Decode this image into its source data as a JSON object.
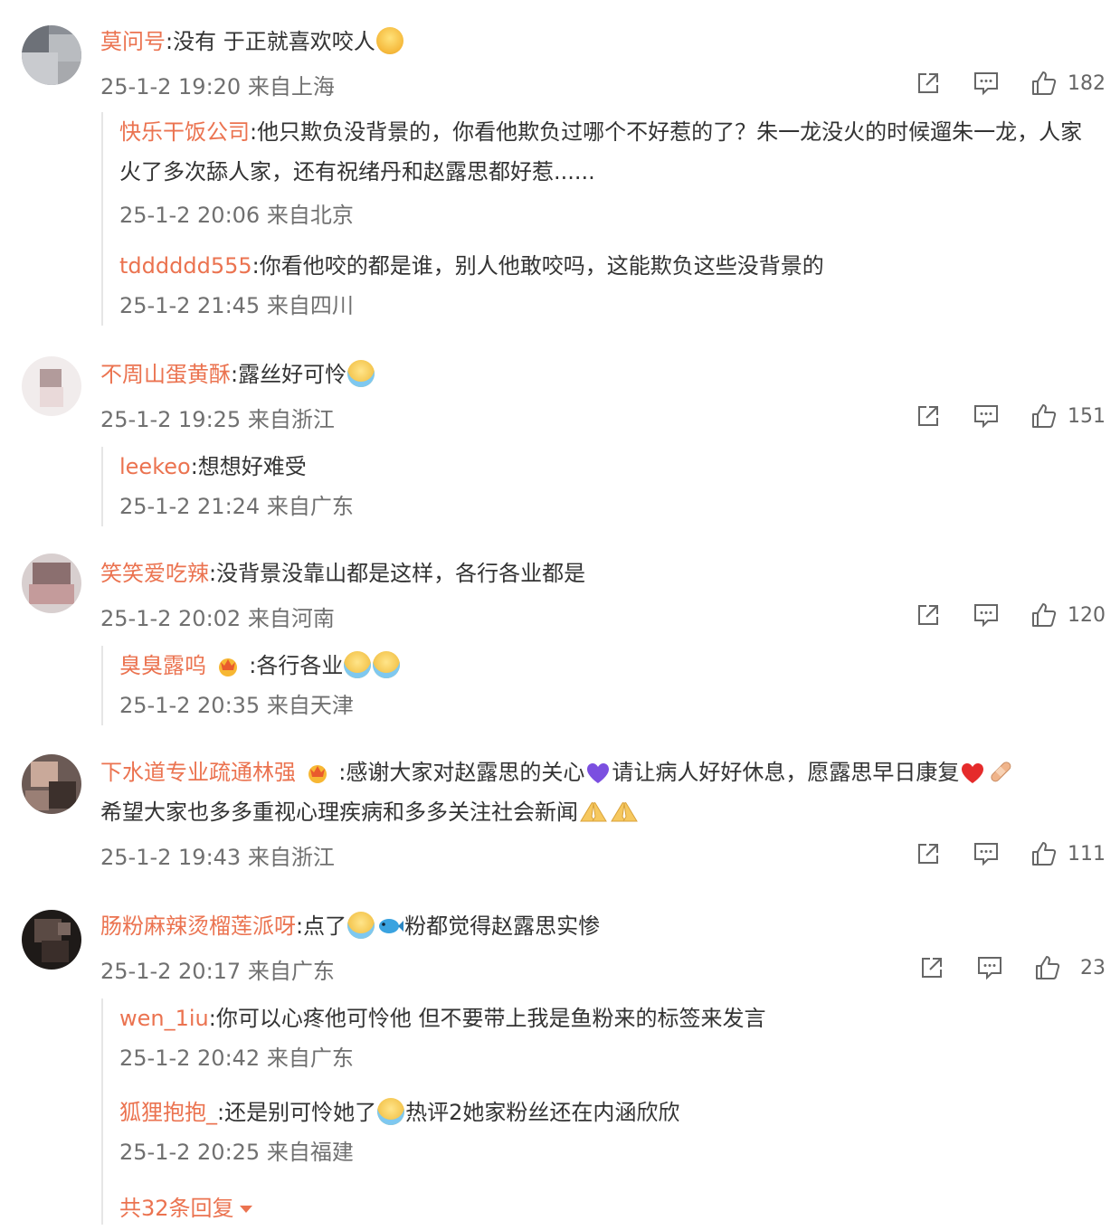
{
  "comments": [
    {
      "user": "莫问号",
      "text_before": ":没有  于正就喜欢咬人",
      "text_after": "",
      "emojis": [
        "laugh"
      ],
      "meta": "25-1-2 19:20 来自上海",
      "likes": "182",
      "replies": [
        {
          "user": "快乐干饭公司",
          "text": ":他只欺负没背景的，你看他欺负过哪个不好惹的了？朱一龙没火的时候遛朱一龙，人家火了多次舔人家，还有祝绪丹和赵露思都好惹......",
          "meta": "25-1-2 20:06 来自北京"
        },
        {
          "user": "tdddddd555",
          "text": ":你看他咬的都是谁，别人他敢咬吗，这能欺负这些没背景的",
          "meta": "25-1-2 21:45 来自四川"
        }
      ]
    },
    {
      "user": "不周山蛋黄酥",
      "text_before": ":露丝好可怜",
      "emojis": [
        "cry"
      ],
      "meta": "25-1-2 19:25 来自浙江",
      "likes": "151",
      "replies": [
        {
          "user": "leekeo",
          "text": ":想想好难受",
          "meta": "25-1-2 21:24 来自广东"
        }
      ]
    },
    {
      "user": "笑笑爱吃辣",
      "text_before": ":没背景没靠山都是这样，各行各业都是",
      "meta": "25-1-2 20:02 来自河南",
      "likes": "120",
      "replies": [
        {
          "user": "臭臭露呜",
          "text": " :各行各业",
          "meta": "25-1-2 20:35 来自天津"
        }
      ]
    },
    {
      "user": "下水道专业疏通林强",
      "text_line1_a": " :感谢大家对赵露思的关心",
      "text_line1_b": "请让病人好好休息，愿露思早日康复",
      "text_line2": "希望大家也多多重视心理疾病和多多关注社会新闻",
      "meta": "25-1-2 19:43 来自浙江",
      "likes": "111"
    },
    {
      "user": "肠粉麻辣烫榴莲派呀",
      "text_a": ":点了",
      "text_b": "粉都觉得赵露思实惨",
      "meta": "25-1-2 20:17 来自广东",
      "likes": "23",
      "replies": [
        {
          "user": "wen_1iu",
          "text": ":你可以心疼他可怜他 但不要带上我是鱼粉来的标签来发言",
          "meta": "25-1-2 20:42 来自广东"
        },
        {
          "user": "狐狸抱抱_",
          "text_a": ":还是别可怜她了",
          "text_b": "热评2她家粉丝还在内涵欣欣",
          "meta": "25-1-2 20:25 来自福建"
        }
      ],
      "more_replies": "共32条回复"
    }
  ],
  "icons": {
    "share": "share-icon",
    "reply": "comment-icon",
    "like": "thumbs-up-icon"
  },
  "colors": {
    "username": "#eb7350",
    "meta": "#707070",
    "text": "#333333"
  }
}
